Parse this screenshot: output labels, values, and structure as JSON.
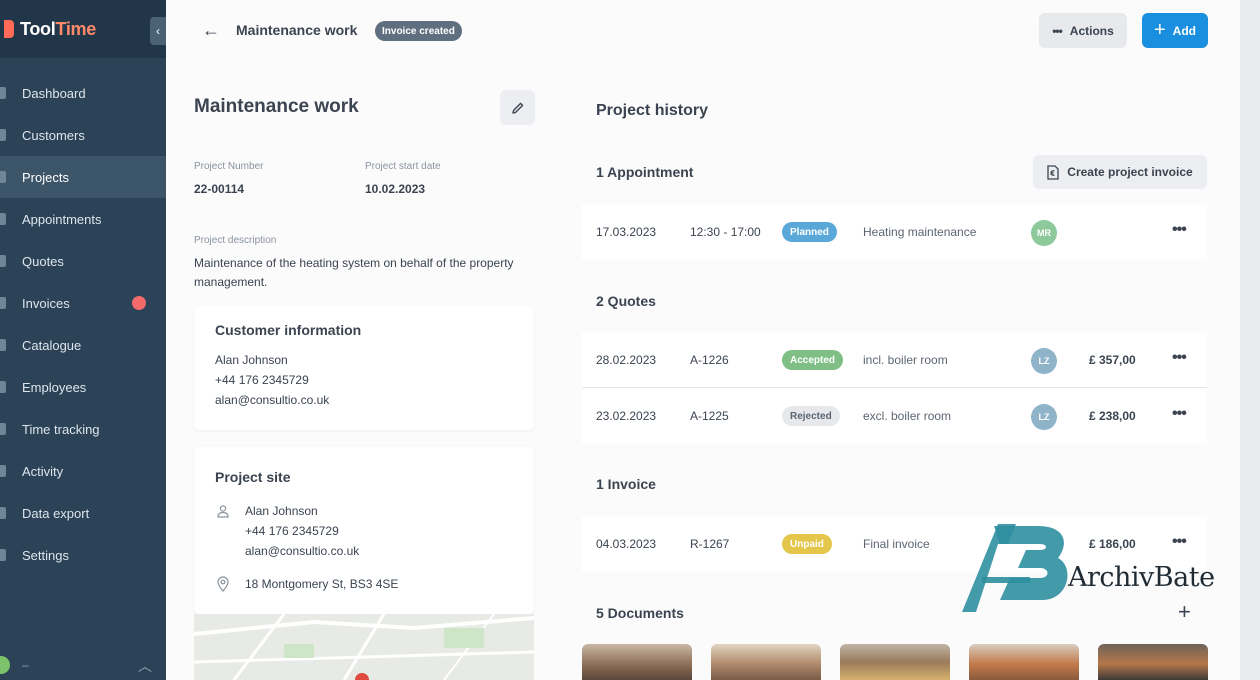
{
  "app": {
    "logo_part1": "Tool",
    "logo_part2": "Time",
    "collapse_icon": "chevron-left-icon"
  },
  "nav": [
    {
      "label": "Dashboard",
      "active": false
    },
    {
      "label": "Customers",
      "active": false
    },
    {
      "label": "Projects",
      "active": true
    },
    {
      "label": "Appointments",
      "active": false
    },
    {
      "label": "Quotes",
      "active": false
    },
    {
      "label": "Invoices",
      "active": false,
      "badge": true
    },
    {
      "label": "Catalogue",
      "active": false
    },
    {
      "label": "Employees",
      "active": false
    },
    {
      "label": "Time tracking",
      "active": false
    },
    {
      "label": "Activity",
      "active": false
    },
    {
      "label": "Data export",
      "active": false
    },
    {
      "label": "Settings",
      "active": false
    }
  ],
  "user": {
    "name": "–"
  },
  "header": {
    "title": "Maintenance work",
    "status": "Invoice created",
    "actions_label": "Actions",
    "add_label": "Add"
  },
  "project": {
    "title": "Maintenance work",
    "number_label": "Project Number",
    "number": "22-00114",
    "start_label": "Project start date",
    "start": "10.02.2023",
    "description_label": "Project description",
    "description": "Maintenance of the heating system on behalf of the property management."
  },
  "customer": {
    "title": "Customer information",
    "name": "Alan Johnson",
    "phone": "+44 176 2345729",
    "email": "alan@consultio.co.uk"
  },
  "site": {
    "title": "Project site",
    "name": "Alan Johnson",
    "phone": "+44 176 2345729",
    "email": "alan@consultio.co.uk",
    "address": "18 Montgomery St, BS3 4SE"
  },
  "history": {
    "title": "Project history",
    "create_invoice_label": "Create project invoice",
    "appointments_title": "1 Appointment",
    "appointments": [
      {
        "date": "17.03.2023",
        "time": "12:30 - 17:00",
        "status": "Planned",
        "status_color": "#5aa8d8",
        "desc": "Heating maintenance",
        "avatar": "MR",
        "avatar_color": "#8dc99a"
      }
    ],
    "quotes_title": "2 Quotes",
    "quotes": [
      {
        "date": "28.02.2023",
        "ref": "A-1226",
        "status": "Accepted",
        "status_color": "#7fbf86",
        "desc": "incl. boiler room",
        "avatar": "LZ",
        "avatar_color": "#8fb3c9",
        "amount": "£ 357,00"
      },
      {
        "date": "23.02.2023",
        "ref": "A-1225",
        "status": "Rejected",
        "status_color": "#e6e8eb",
        "desc": "excl. boiler room",
        "avatar": "LZ",
        "avatar_color": "#8fb3c9",
        "amount": "£ 238,00"
      }
    ],
    "invoices_title": "1 Invoice",
    "invoices": [
      {
        "date": "04.03.2023",
        "ref": "R-1267",
        "status": "Unpaid",
        "status_color": "#e4c64a",
        "desc": "Final invoice",
        "amount": "£ 186,00"
      }
    ],
    "documents_title": "5 Documents"
  },
  "watermark": {
    "text": "ArchivBate"
  }
}
